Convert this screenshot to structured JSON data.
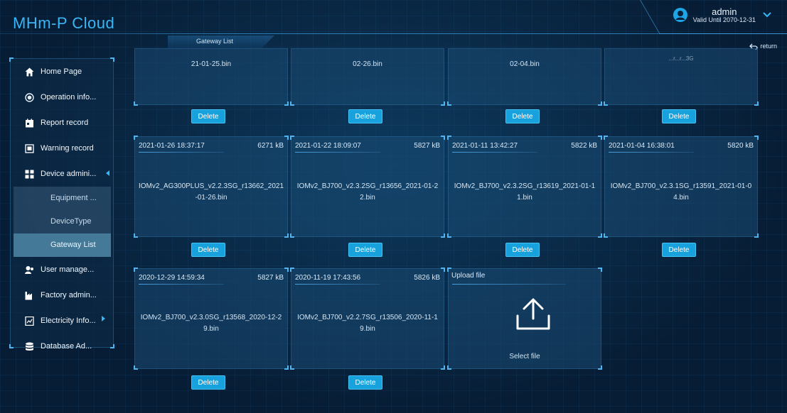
{
  "app": {
    "title": "MHm-P Cloud"
  },
  "user": {
    "name": "admin",
    "valid_until": "Valid Until 2070-12-31"
  },
  "breadcrumb": {
    "current": "Gateway List"
  },
  "return_label": "return",
  "sidebar": {
    "items": [
      {
        "label": "Home Page"
      },
      {
        "label": "Operation info..."
      },
      {
        "label": "Report record"
      },
      {
        "label": "Warning record"
      },
      {
        "label": "Device admini..."
      },
      {
        "label": "User manage..."
      },
      {
        "label": "Factory admin..."
      },
      {
        "label": "Electricity Info..."
      },
      {
        "label": "Database Ad..."
      }
    ],
    "submenu": [
      {
        "label": "Equipment ..."
      },
      {
        "label": "DeviceType"
      },
      {
        "label": "Gateway List"
      }
    ]
  },
  "files_row1": [
    {
      "name": "21-01-25.bin"
    },
    {
      "name": "02-26.bin"
    },
    {
      "name": "02-04.bin"
    },
    {
      "name": "...r...r...3G"
    }
  ],
  "files_row2": [
    {
      "date": "2021-01-26 18:37:17",
      "size": "6271 kB",
      "name": "IOMv2_AG300PLUS_v2.2.3SG_r13662_2021-01-26.bin"
    },
    {
      "date": "2021-01-22 18:09:07",
      "size": "5827 kB",
      "name": "IOMv2_BJ700_v2.3.2SG_r13656_2021-01-22.bin"
    },
    {
      "date": "2021-01-11 13:42:27",
      "size": "5822 kB",
      "name": "IOMv2_BJ700_v2.3.2SG_r13619_2021-01-11.bin"
    },
    {
      "date": "2021-01-04 16:38:01",
      "size": "5820 kB",
      "name": "IOMv2_BJ700_v2.3.1SG_r13591_2021-01-04.bin"
    }
  ],
  "files_row3": [
    {
      "date": "2020-12-29 14:59:34",
      "size": "5827 kB",
      "name": "IOMv2_BJ700_v2.3.0SG_r13568_2020-12-29.bin"
    },
    {
      "date": "2020-11-19 17:43:56",
      "size": "5826 kB",
      "name": "IOMv2_BJ700_v2.2.7SG_r13506_2020-11-19.bin"
    }
  ],
  "upload": {
    "title": "Upload file",
    "select_label": "Select file"
  },
  "delete_label": "Delete",
  "colors": {
    "accent": "#38b6f5",
    "button": "#17a2dd",
    "background": "#07203a"
  },
  "icons": {
    "user": "user-avatar-icon",
    "dropdown": "chevron-down-icon",
    "return": "return-arrow-icon",
    "upload": "upload-icon"
  }
}
